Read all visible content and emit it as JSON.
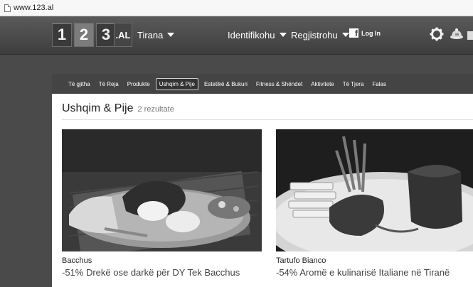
{
  "browser": {
    "url": "www.123.al"
  },
  "header": {
    "logo_digits": [
      "1",
      "2",
      "3"
    ],
    "logo_tld": ".AL",
    "city": "Tirana",
    "login_label": "Identifikohu",
    "register_label": "Regjistrohu",
    "facebook_label": "Log In",
    "icons": [
      "gear-icon",
      "deal-icon",
      "mail-icon"
    ]
  },
  "categories": [
    {
      "label": "Të gjitha",
      "active": false
    },
    {
      "label": "Të Reja",
      "active": false
    },
    {
      "label": "Produkte",
      "active": false
    },
    {
      "label": "Ushqim & Pije",
      "active": true
    },
    {
      "label": "Estetikë & Bukuri",
      "active": false
    },
    {
      "label": "Fitness & Shëndet",
      "active": false
    },
    {
      "label": "Aktivitete",
      "active": false
    },
    {
      "label": "Të Tjera",
      "active": false
    },
    {
      "label": "Falas",
      "active": false
    }
  ],
  "main": {
    "title": "Ushqim & Pije",
    "result_count": "2 rezultate"
  },
  "deals": [
    {
      "venue": "Bacchus",
      "offer": "-51% Drekë ose darkë për DY Tek Bacchus"
    },
    {
      "venue": "Tartufo Bianco",
      "offer": "-54% Aromë e kulinarisë Italiane në Tiranë"
    }
  ]
}
